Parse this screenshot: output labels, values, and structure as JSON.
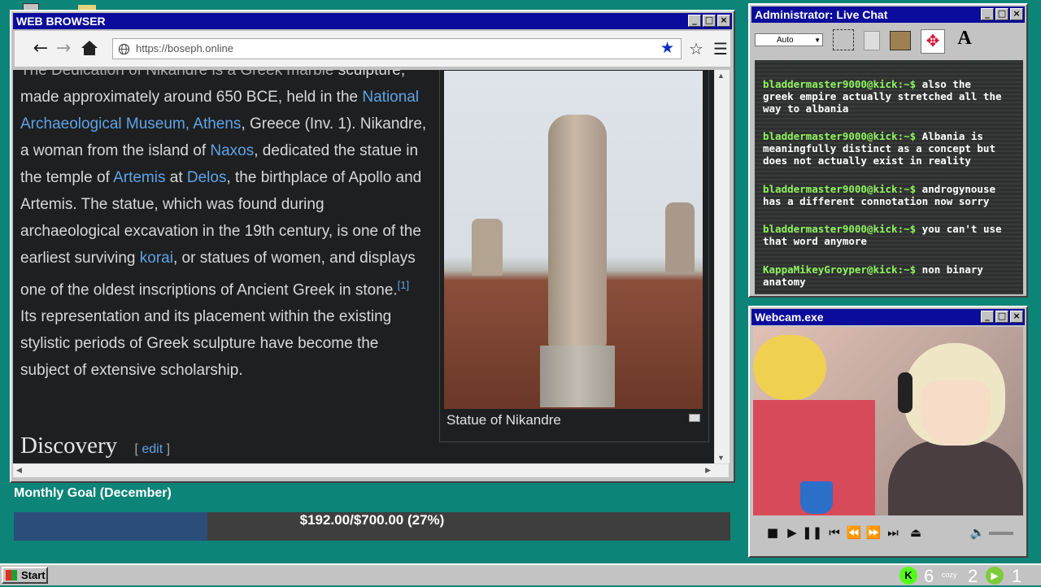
{
  "desktop": {
    "bg_color": "#0d8478"
  },
  "browser": {
    "title": "WEB BROWSER",
    "url": "https://boseph.online",
    "article": {
      "top_cut": "The Dedication of Nikandre is a Greek marble",
      "p1": "sculpture, made approximately around 650 BCE, held in the ",
      "link_museum": "National Archaeological Museum, Athens",
      "p2": ", Greece (Inv. 1). Nikandre, a woman from the island of ",
      "link_naxos": "Naxos",
      "p3": ", dedicated the statue in the temple of ",
      "link_artemis": "Artemis",
      "p4": " at ",
      "link_delos": "Delos",
      "p5": ", the birthplace of Apollo and Artemis. The statue, which was found during archaeological excavation in the 19th century, is one of the earliest surviving ",
      "link_korai": "korai",
      "p6": ", or statues of women, and displays one of the oldest inscriptions of Ancient Greek in stone.",
      "ref": "[1]",
      "p7": " Its representation and its placement within the existing stylistic periods of Greek sculpture have become the subject of extensive scholarship."
    },
    "section_heading": "Discovery",
    "edit_open": "[",
    "edit_label": "edit",
    "edit_close": "]",
    "figure_caption": "Statue of Nikandre"
  },
  "goal": {
    "title": "Monthly Goal (December)",
    "text": "$192.00/$700.00 (27%)",
    "fraction": 0.27,
    "fill_color": "#2c4d7a"
  },
  "chat": {
    "title": "Administrator: Live Chat",
    "font_select": "Auto",
    "font_tool": "A",
    "messages": [
      {
        "user": "bladdermaster9000@kick:~$",
        "text": " also the greek empire actually stretched all the way to albania"
      },
      {
        "user": "bladdermaster9000@kick:~$",
        "text": " Albania is meaningfully distinct as a concept but does not actually exist in reality"
      },
      {
        "user": "bladdermaster9000@kick:~$",
        "text": " androgynouse has a different connotation now sorry"
      },
      {
        "user": "bladdermaster9000@kick:~$",
        "text": " you can't use that word anymore"
      },
      {
        "user": "KappaMikeyGroyper@kick:~$",
        "text": " non binary anatomy"
      }
    ]
  },
  "webcam": {
    "title": "Webcam.exe"
  },
  "taskbar": {
    "start": "Start",
    "tray_count_1": "6",
    "tray_label": "cozy",
    "tray_count_2": "2",
    "tray_count_3": "1",
    "kick_letter": "K"
  }
}
